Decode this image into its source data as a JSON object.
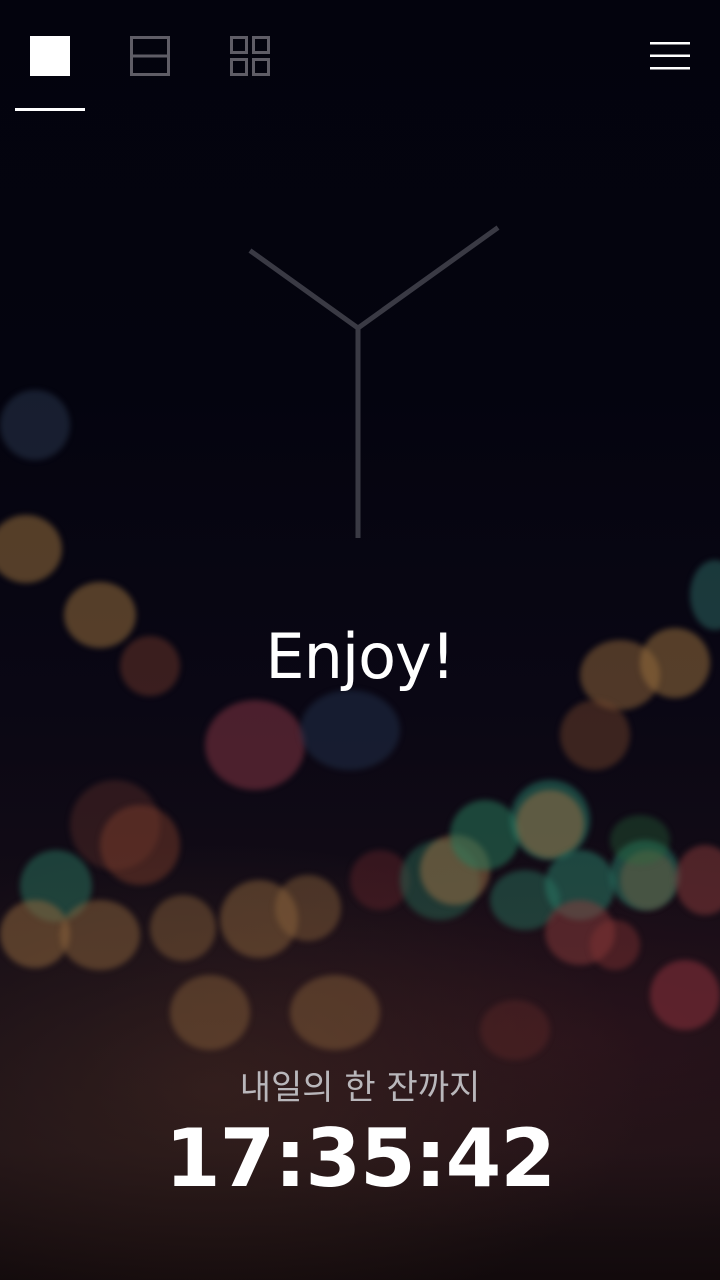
{
  "toolbar": {
    "views": [
      {
        "name": "single-view",
        "icon": "single-square-icon",
        "selected": true
      },
      {
        "name": "split-view",
        "icon": "split-horizontal-icon",
        "selected": false
      },
      {
        "name": "grid-view",
        "icon": "grid-2x2-icon",
        "selected": false
      }
    ],
    "menu_icon": "hamburger-menu-icon"
  },
  "main": {
    "illustration_icon": "glass-icon",
    "message": "Enjoy!"
  },
  "countdown": {
    "label": "내일의 한 잔까지",
    "time": "17:35:42"
  },
  "colors": {
    "background": "#04040e",
    "text": "#ffffff",
    "muted_text": "#b9b7bb",
    "inactive_icon": "#5f5d66",
    "glass_stroke": "#3a3a44"
  }
}
